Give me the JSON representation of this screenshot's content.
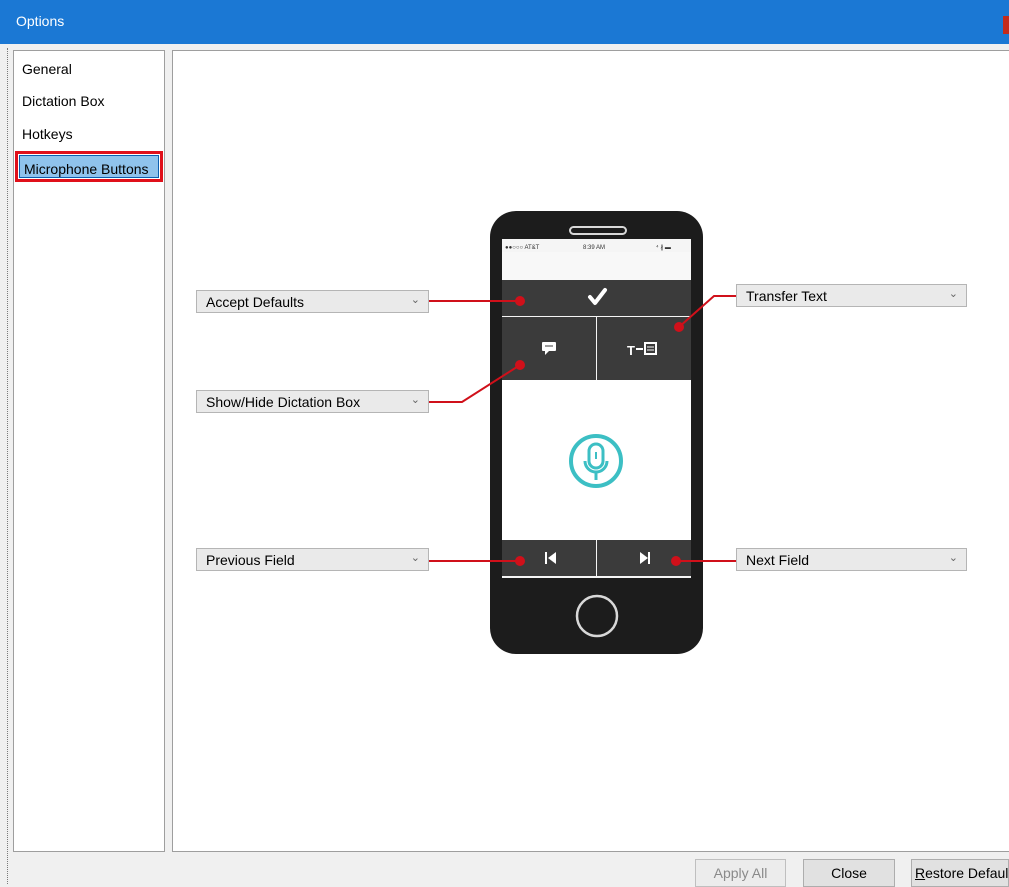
{
  "window": {
    "title": "Options"
  },
  "sidebar": {
    "items": [
      {
        "label": "General"
      },
      {
        "label": "Dictation Box"
      },
      {
        "label": "Hotkeys"
      },
      {
        "label": "Microphone Buttons",
        "selected": true
      }
    ]
  },
  "phone": {
    "status_carrier": "●●○○○ AT&T",
    "status_time": "8:39 AM",
    "status_right": "⁴ ∦ ▬",
    "buttons": {
      "top": "checkmark-icon",
      "middle_left": "dictation-box-icon",
      "middle_right": "transfer-text-icon",
      "center": "microphone-icon",
      "bottom_left": "previous-field-icon",
      "bottom_right": "next-field-icon"
    }
  },
  "mappings": {
    "accept_defaults": "Accept Defaults",
    "show_hide_dictation": "Show/Hide Dictation Box",
    "previous_field": "Previous Field",
    "transfer_text": "Transfer Text",
    "next_field": "Next Field"
  },
  "footer": {
    "apply_all": "Apply All",
    "close": "Close",
    "restore_defaults_first": "R",
    "restore_defaults_rest": "estore Defaults"
  },
  "colors": {
    "titlebar": "#1b78d4",
    "connector": "#d0101a",
    "selection": "#8fc3ec",
    "phone_body": "#1c1c1c",
    "phone_button_bg": "#3b3b3b",
    "mic_accent": "#3cbfc4"
  }
}
